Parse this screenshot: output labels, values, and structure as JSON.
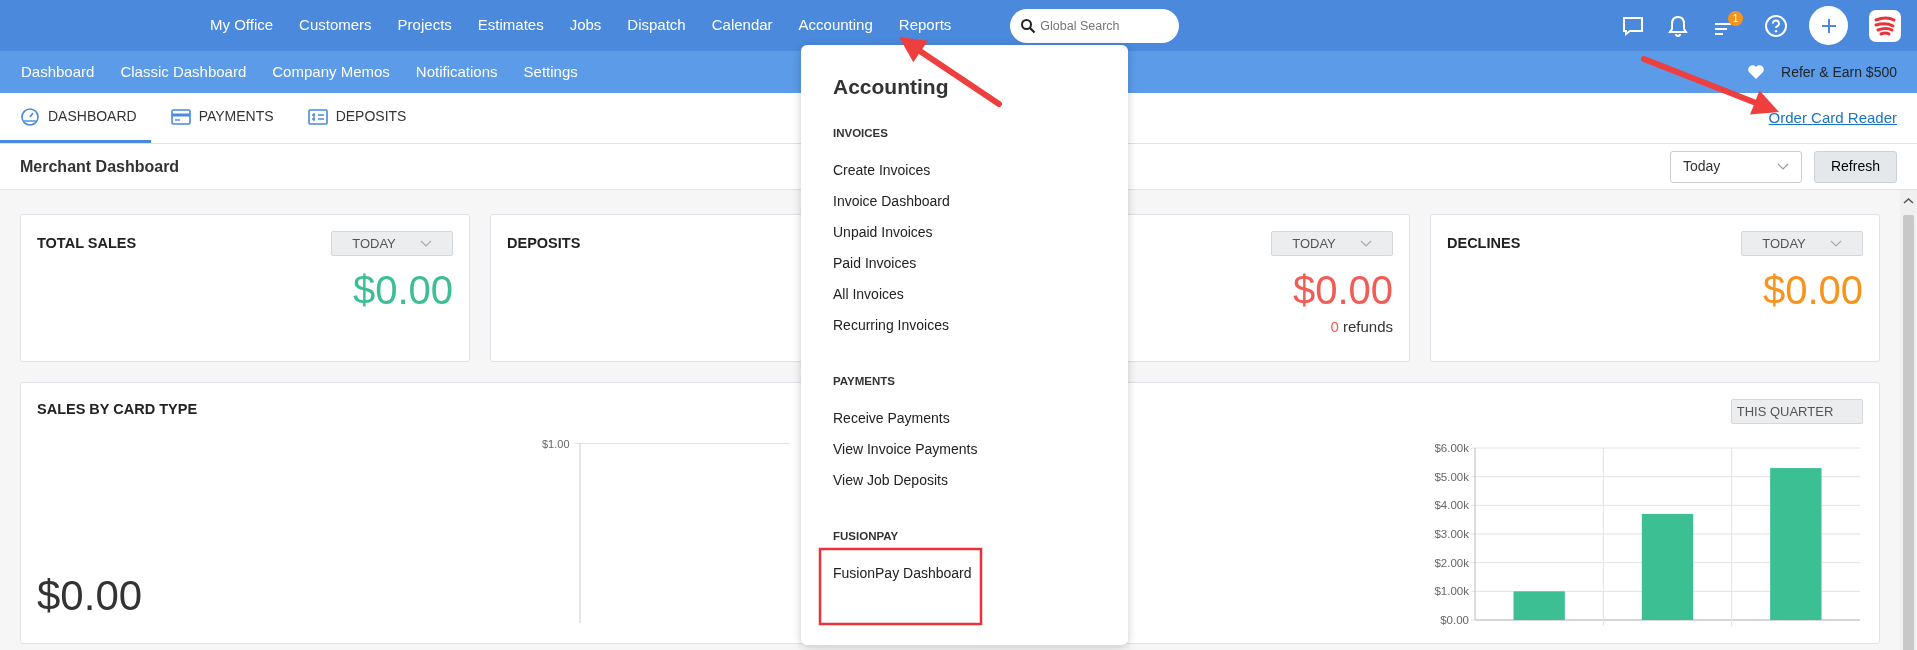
{
  "top_nav": {
    "items": [
      "My Office",
      "Customers",
      "Projects",
      "Estimates",
      "Jobs",
      "Dispatch",
      "Calendar",
      "Accounting",
      "Reports"
    ],
    "search": {
      "placeholder": "Global Search"
    },
    "notification_badge": "1"
  },
  "sub_nav": {
    "items": [
      "Dashboard",
      "Classic Dashboard",
      "Company Memos",
      "Notifications",
      "Settings"
    ],
    "refer": "Refer & Earn $500"
  },
  "tabs": [
    {
      "label": "DASHBOARD",
      "selected": true
    },
    {
      "label": "PAYMENTS",
      "selected": false
    },
    {
      "label": "DEPOSITS",
      "selected": false
    }
  ],
  "order_link": "Order Card Reader",
  "page_title": "Merchant Dashboard",
  "period_select": "Today",
  "refresh_button": "Refresh",
  "cards": [
    {
      "title": "TOTAL SALES",
      "period": "TODAY",
      "amount": "$0.00",
      "color": "#3dbf94"
    },
    {
      "title": "DEPOSITS"
    },
    {
      "period": "TODAY",
      "amount": "$0.00",
      "color": "#f25c54",
      "refunds_count": "0",
      "refunds_label": "refunds"
    },
    {
      "title": "DECLINES",
      "period": "TODAY",
      "amount": "$0.00",
      "color": "#f7941d"
    }
  ],
  "sales_by_card_type": {
    "title": "SALES BY CARD TYPE",
    "amount": "$0.00",
    "axis_label": "$1.00"
  },
  "sales_panel": {
    "period": "THIS QUARTER",
    "chart_data": {
      "type": "bar",
      "grid": true,
      "values": [
        1000,
        3700,
        5300
      ],
      "ylim": [
        0,
        6000
      ],
      "yticks": [
        {
          "value": 0,
          "label": "$0.00"
        },
        {
          "value": 1000,
          "label": "$1.00k"
        },
        {
          "value": 2000,
          "label": "$2.00k"
        },
        {
          "value": 3000,
          "label": "$3.00k"
        },
        {
          "value": 4000,
          "label": "$4.00k"
        },
        {
          "value": 5000,
          "label": "$5.00k"
        },
        {
          "value": 6000,
          "label": "$6.00k"
        }
      ]
    }
  },
  "accounting_menu": {
    "title": "Accounting",
    "sections": [
      {
        "heading": "INVOICES",
        "items": [
          "Create Invoices",
          "Invoice Dashboard",
          "Unpaid Invoices",
          "Paid Invoices",
          "All Invoices",
          "Recurring Invoices"
        ]
      },
      {
        "heading": "PAYMENTS",
        "items": [
          "Receive Payments",
          "View Invoice Payments",
          "View Job Deposits"
        ]
      },
      {
        "heading": "FUSIONPAY",
        "items": [
          "FusionPay Dashboard"
        ]
      }
    ]
  },
  "annotations": [
    {
      "kind": "arrow"
    },
    {
      "kind": "arrow"
    },
    {
      "kind": "highlight"
    }
  ]
}
